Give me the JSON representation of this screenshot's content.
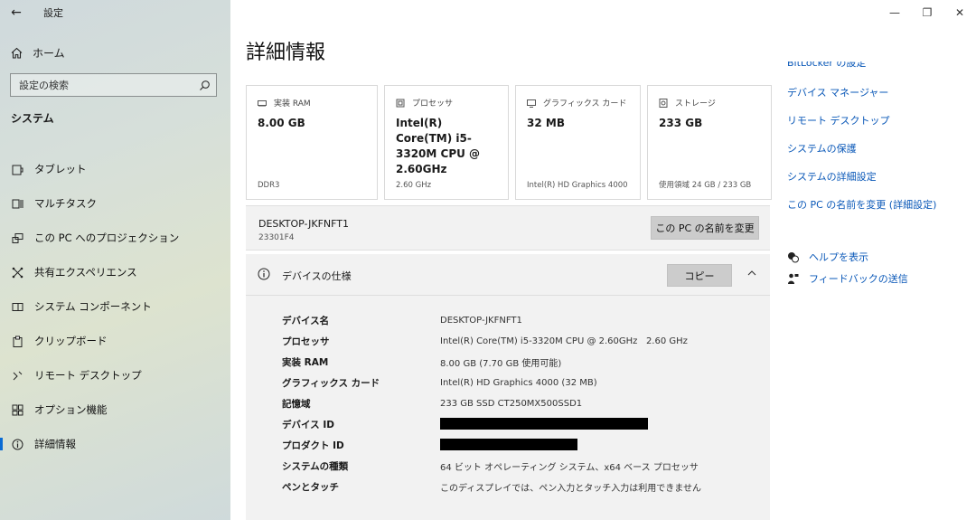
{
  "window": {
    "title": "設定",
    "minimize": "—",
    "maximize": "❐",
    "close": "✕"
  },
  "sidebar": {
    "home": "ホーム",
    "search_placeholder": "設定の検索",
    "section": "システム",
    "items": [
      {
        "label": "タブレット",
        "icon": "tablet-icon"
      },
      {
        "label": "マルチタスク",
        "icon": "multitask-icon"
      },
      {
        "label": "この PC へのプロジェクション",
        "icon": "projection-icon"
      },
      {
        "label": "共有エクスペリエンス",
        "icon": "shared-experience-icon"
      },
      {
        "label": "システム コンポーネント",
        "icon": "component-icon"
      },
      {
        "label": "クリップボード",
        "icon": "clipboard-icon"
      },
      {
        "label": "リモート デスクトップ",
        "icon": "remote-desktop-icon"
      },
      {
        "label": "オプション機能",
        "icon": "optional-features-icon"
      },
      {
        "label": "詳細情報",
        "icon": "info-icon",
        "active": true
      }
    ]
  },
  "main": {
    "title": "詳細情報",
    "cards": [
      {
        "head": "実装 RAM",
        "value": "8.00 GB",
        "sub": "DDR3",
        "icon": "ram-icon"
      },
      {
        "head": "プロセッサ",
        "value": "Intel(R) Core(TM) i5-3320M CPU @ 2.60GHz",
        "sub": "2.60 GHz",
        "icon": "processor-icon"
      },
      {
        "head": "グラフィックス カード",
        "value": "32 MB",
        "sub": "Intel(R) HD Graphics 4000",
        "icon": "graphics-icon"
      },
      {
        "head": "ストレージ",
        "value": "233 GB",
        "sub": "使用領域 24 GB / 233 GB",
        "icon": "storage-icon"
      }
    ],
    "pc_name": "DESKTOP-JKFNFT1",
    "pc_id": "23301F4",
    "rename_button": "この PC の名前を変更",
    "spec": {
      "title": "デバイスの仕様",
      "copy_button": "コピー",
      "rows": [
        {
          "key": "デバイス名",
          "value": "DESKTOP-JKFNFT1"
        },
        {
          "key": "プロセッサ",
          "value": "Intel(R) Core(TM) i5-3320M CPU @ 2.60GHz   2.60 GHz"
        },
        {
          "key": "実装 RAM",
          "value": "8.00 GB (7.70 GB 使用可能)"
        },
        {
          "key": "グラフィックス カード",
          "value": "Intel(R) HD Graphics 4000 (32 MB)"
        },
        {
          "key": "記憶域",
          "value": "233 GB SSD CT250MX500SSD1"
        },
        {
          "key": "デバイス ID",
          "value": "",
          "redacted": true
        },
        {
          "key": "プロダクト ID",
          "value": "",
          "redacted": true
        },
        {
          "key": "システムの種類",
          "value": "64 ビット オペレーティング システム、x64 ベース プロセッサ"
        },
        {
          "key": "ペンとタッチ",
          "value": "このディスプレイでは、ペン入力とタッチ入力は利用できません"
        }
      ]
    }
  },
  "related_links": [
    "BitLocker の設定",
    "デバイス マネージャー",
    "リモート デスクトップ",
    "システムの保護",
    "システムの詳細設定",
    "この PC の名前を変更 (詳細設定)"
  ],
  "help": {
    "show_help": "ヘルプを表示",
    "feedback": "フィードバックの送信"
  },
  "colors": {
    "link": "#0a58b8",
    "accent": "#0a6bd4",
    "panel": "#f2f2f2",
    "button": "#cccccc"
  }
}
